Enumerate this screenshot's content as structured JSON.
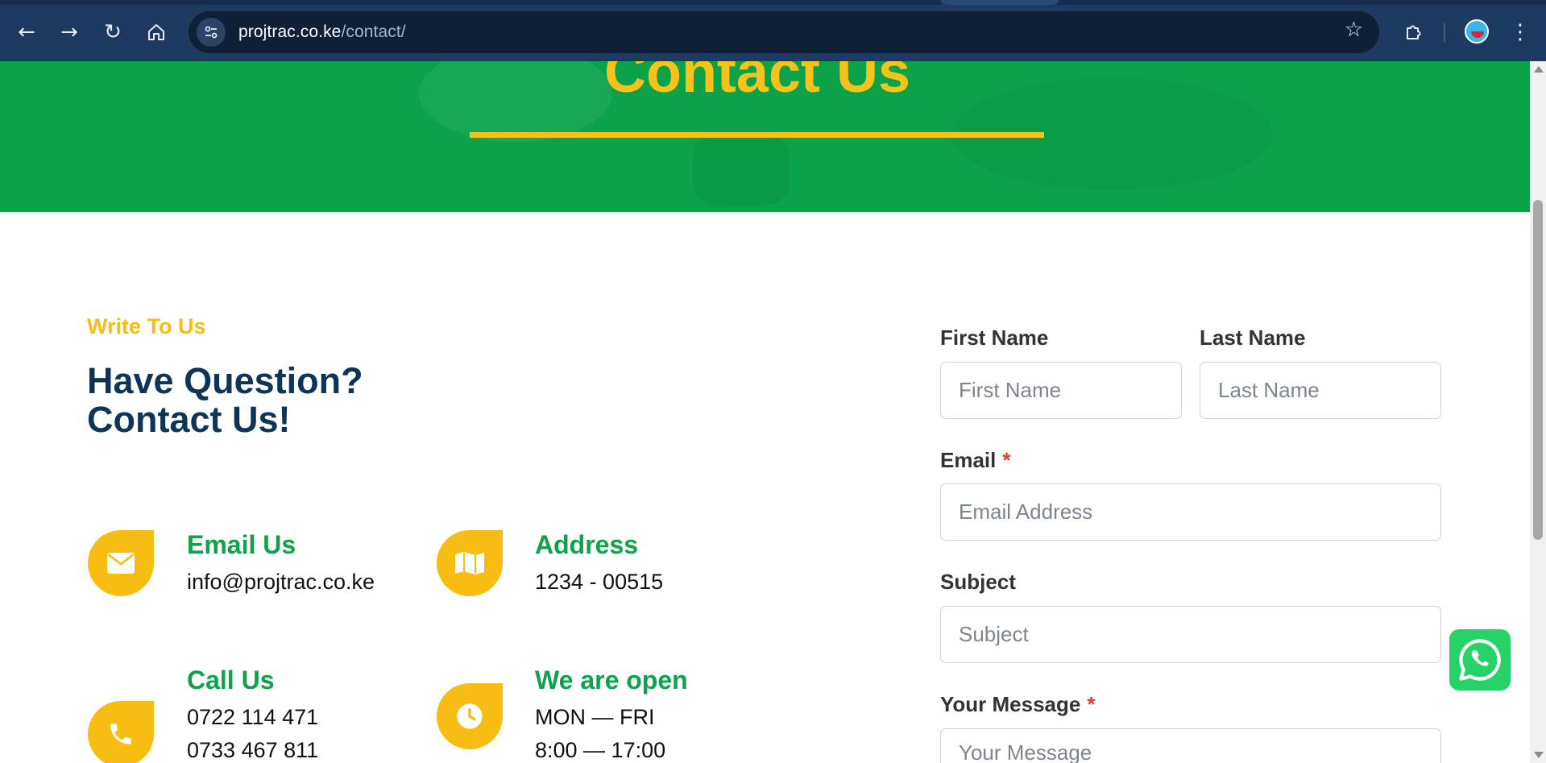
{
  "browser": {
    "url_domain": "projtrac.co.ke",
    "url_path": "/contact/",
    "icons": {
      "back": "back-arrow-icon",
      "forward": "forward-arrow-icon",
      "reload": "reload-icon",
      "home": "home-icon",
      "site_info": "site-info-icon",
      "bookmark": "star-icon",
      "extensions": "puzzle-icon",
      "profile": "avatar",
      "menu": "kebab-menu-icon"
    }
  },
  "hero": {
    "title": "Contact Us"
  },
  "intro": {
    "eyebrow": "Write To Us",
    "heading_line1": "Have Question?",
    "heading_line2": "Contact Us!"
  },
  "info": {
    "email": {
      "title": "Email Us",
      "line1": "info@projtrac.co.ke",
      "icon": "envelope-icon"
    },
    "address": {
      "title": "Address",
      "line1": "1234 - 00515",
      "icon": "map-icon"
    },
    "call": {
      "title": "Call Us",
      "line1": "0722 114 471",
      "line2": "0733 467 811",
      "icon": "phone-icon"
    },
    "hours": {
      "title": "We are open",
      "line1": "MON — FRI",
      "line2": "8:00 — 17:00",
      "icon": "clock-icon"
    }
  },
  "form": {
    "first_name": {
      "label": "First Name",
      "placeholder": "First Name"
    },
    "last_name": {
      "label": "Last Name",
      "placeholder": "Last Name"
    },
    "email": {
      "label": "Email",
      "required_mark": "*",
      "placeholder": "Email Address"
    },
    "subject": {
      "label": "Subject",
      "placeholder": "Subject"
    },
    "message": {
      "label": "Your Message",
      "required_mark": "*",
      "placeholder": "Your Message"
    }
  },
  "widgets": {
    "whatsapp": "whatsapp-icon"
  },
  "colors": {
    "chrome": "#1d3a63",
    "hero_green": "#0ca24a",
    "accent_yellow": "#f7bd12",
    "heading_navy": "#0e3457",
    "info_green": "#0fa24a",
    "required_red": "#e2402f",
    "whatsapp_green": "#25d366"
  }
}
